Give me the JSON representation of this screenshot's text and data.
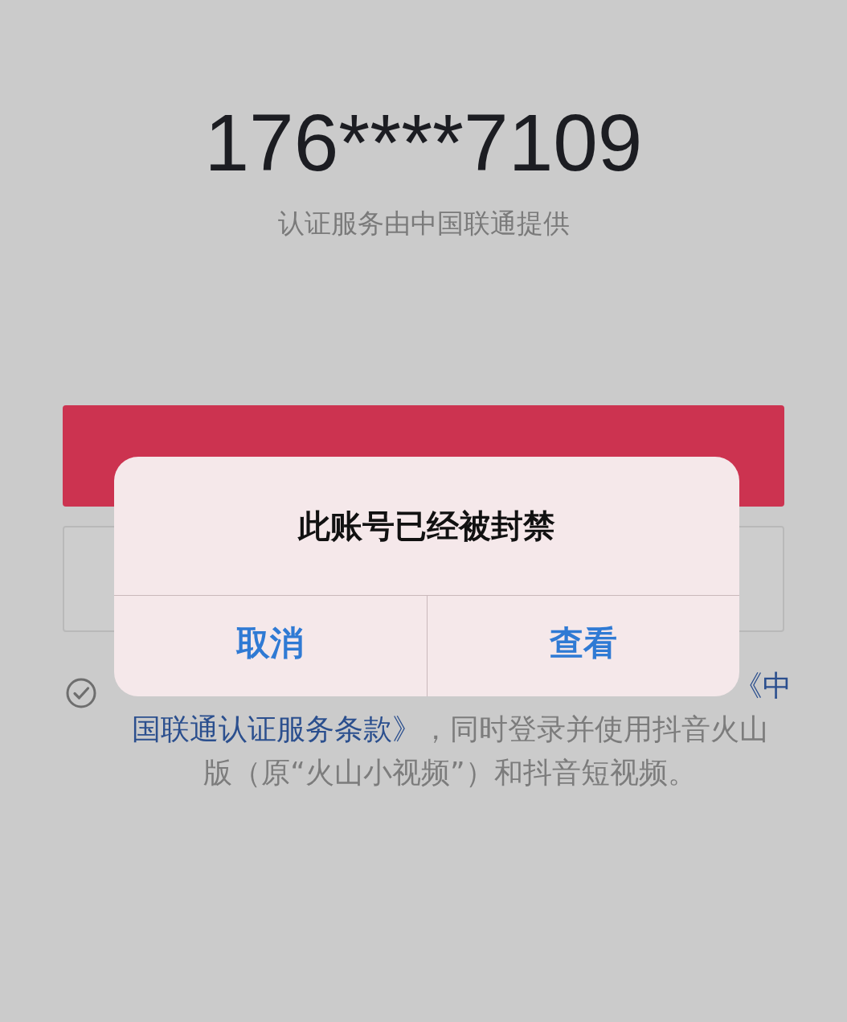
{
  "phone_number": "176****7109",
  "provider_note": "认证服务由中国联通提供",
  "consent": {
    "checked": false,
    "lines": [
      {
        "segments": [
          {
            "text": "《中",
            "link": true
          }
        ]
      },
      {
        "segments": [
          {
            "text": "国联通认证服务条款》",
            "link": true
          },
          {
            "text": "，同时登录并使用抖音火山",
            "link": false
          }
        ]
      },
      {
        "segments": [
          {
            "text": "版（原“火山小视频”）和抖音短视频。",
            "link": false
          }
        ]
      }
    ]
  },
  "dialog": {
    "title": "此账号已经被封禁",
    "buttons": [
      {
        "label": "取消"
      },
      {
        "label": "查看"
      }
    ]
  }
}
